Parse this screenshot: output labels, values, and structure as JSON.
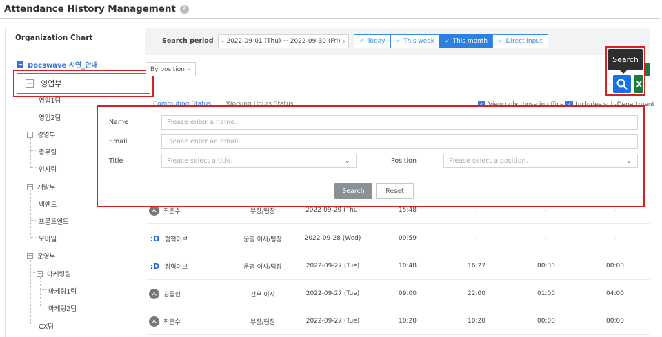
{
  "header": {
    "title": "Attendance History Management",
    "help_icon": "question-circle-icon"
  },
  "sidebar": {
    "title": "Organization Chart",
    "root": "Docswave 시연_안내",
    "selected": "영업부",
    "nodes": {
      "sales1": "영업1팀",
      "sales2": "영업2팀",
      "mgmt": "경영부",
      "general": "총무팀",
      "hr": "인사팀",
      "dev": "개발부",
      "backend": "백엔드",
      "frontend": "프론트엔드",
      "mobile": "모바일",
      "ops": "운영부",
      "marketing": "마케팅팀",
      "marketing1": "마케팅1팀",
      "marketing2": "마케팅2팀",
      "cx": "CX팀"
    }
  },
  "filter": {
    "search_period_label": "Search period",
    "date_range": "2022-09-01 (Thu) ~ 2022-09-30 (Fri)",
    "range_buttons": [
      "Today",
      "This week",
      "This month",
      "Direct input"
    ],
    "active_range": "This month",
    "position_dropdown": "By position"
  },
  "tabs": {
    "commuting": "Commuting Status",
    "working": "Working Hours Status"
  },
  "options": {
    "view_in_office": "View only those in office",
    "include_sub": "Includes sub-Department"
  },
  "tooltip": {
    "search": "Search"
  },
  "search_panel": {
    "name_label": "Name",
    "name_placeholder": "Please enter a name.",
    "email_label": "Email",
    "email_placeholder": "Please enter an email.",
    "title_label": "Title",
    "title_placeholder": "Please select a title.",
    "position_label": "Position",
    "position_placeholder": "Please select a position.",
    "search_button": "Search",
    "reset_button": "Reset"
  },
  "rows": [
    {
      "name": "최준수",
      "position": "부장/팀장",
      "date": "2022-09-29 (Thu)",
      "in": "15:48",
      "out": "-",
      "ot": "-",
      "x": "-",
      "avatar": "gray"
    },
    {
      "name": "정혁이브",
      "position": "운영 이사/팀장",
      "date": "2022-09-28 (Wed)",
      "in": "09:59",
      "out": "-",
      "ot": "-",
      "x": "-",
      "avatar": "blue"
    },
    {
      "name": "정혁이브",
      "position": "운영 이사/팀장",
      "date": "2022-09-27 (Tue)",
      "in": "10:48",
      "out": "16:27",
      "ot": "00:30",
      "x": "00:00",
      "avatar": "blue"
    },
    {
      "name": "김동현",
      "position": "전무 이사",
      "date": "2022-09-27 (Tue)",
      "in": "09:00",
      "out": "22:00",
      "ot": "01:00",
      "x": "04:00",
      "avatar": "gray"
    },
    {
      "name": "최준수",
      "position": "부장/팀장",
      "date": "2022-09-27 (Tue)",
      "in": "10:20",
      "out": "10:20",
      "ot": "00:00",
      "x": "00:00",
      "avatar": "gray"
    }
  ]
}
